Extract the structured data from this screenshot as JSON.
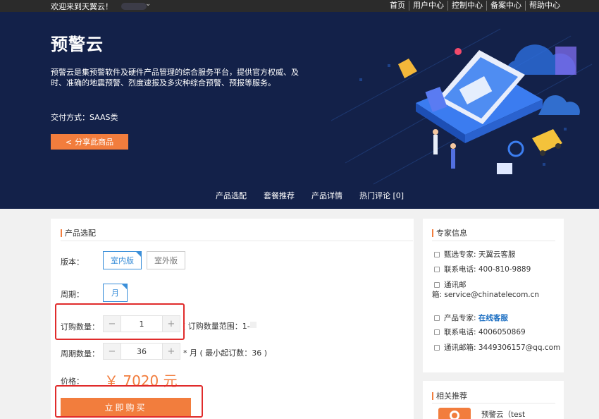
{
  "topbar": {
    "welcome": "欢迎来到天翼云！",
    "nav": [
      "首页",
      "用户中心",
      "控制中心",
      "备案中心",
      "帮助中心"
    ]
  },
  "hero": {
    "title": "预警云",
    "desc": "预警云是集预警软件及硬件产品管理的综合服务平台，提供官方权威、及时、准确的地震预警、烈度速报及多灾种综合预警、预报等服务。",
    "delivery": "交付方式：SAAS类",
    "share_label": "分享此商品",
    "tabs": [
      "产品选配",
      "套餐推荐",
      "产品详情",
      "热门评论 [0]"
    ]
  },
  "config": {
    "section_title": "产品选配",
    "version_label": "版本：",
    "version_options": [
      "室内版",
      "室外版"
    ],
    "period_label": "周期：",
    "period_options": [
      "月"
    ],
    "qty_label": "订购数量：",
    "qty_value": "1",
    "qty_note": "( 订购数量范围：1-",
    "period_qty_label": "周期数量：",
    "period_qty_value": "36",
    "period_qty_note": "* 月 ( 最小起订数：36 )",
    "price_label": "价格：",
    "price": "￥ 7020 元",
    "buy_label": "立即购买"
  },
  "expert": {
    "section_title": "专家信息",
    "selected_expert": "甄选专家: 天翼云客服",
    "phone1": "联系电话: 400-810-9889",
    "email_label_line1": "通讯邮",
    "email_line2": "箱: service@chinatelecom.cn",
    "product_expert_label": "产品专家:",
    "product_expert_link": "在线客服",
    "phone2": "联系电话: 4006050869",
    "email2": "通讯邮箱: 3449306157@qq.com"
  },
  "related": {
    "section_title": "相关推荐",
    "item_title": "预警云（test"
  }
}
